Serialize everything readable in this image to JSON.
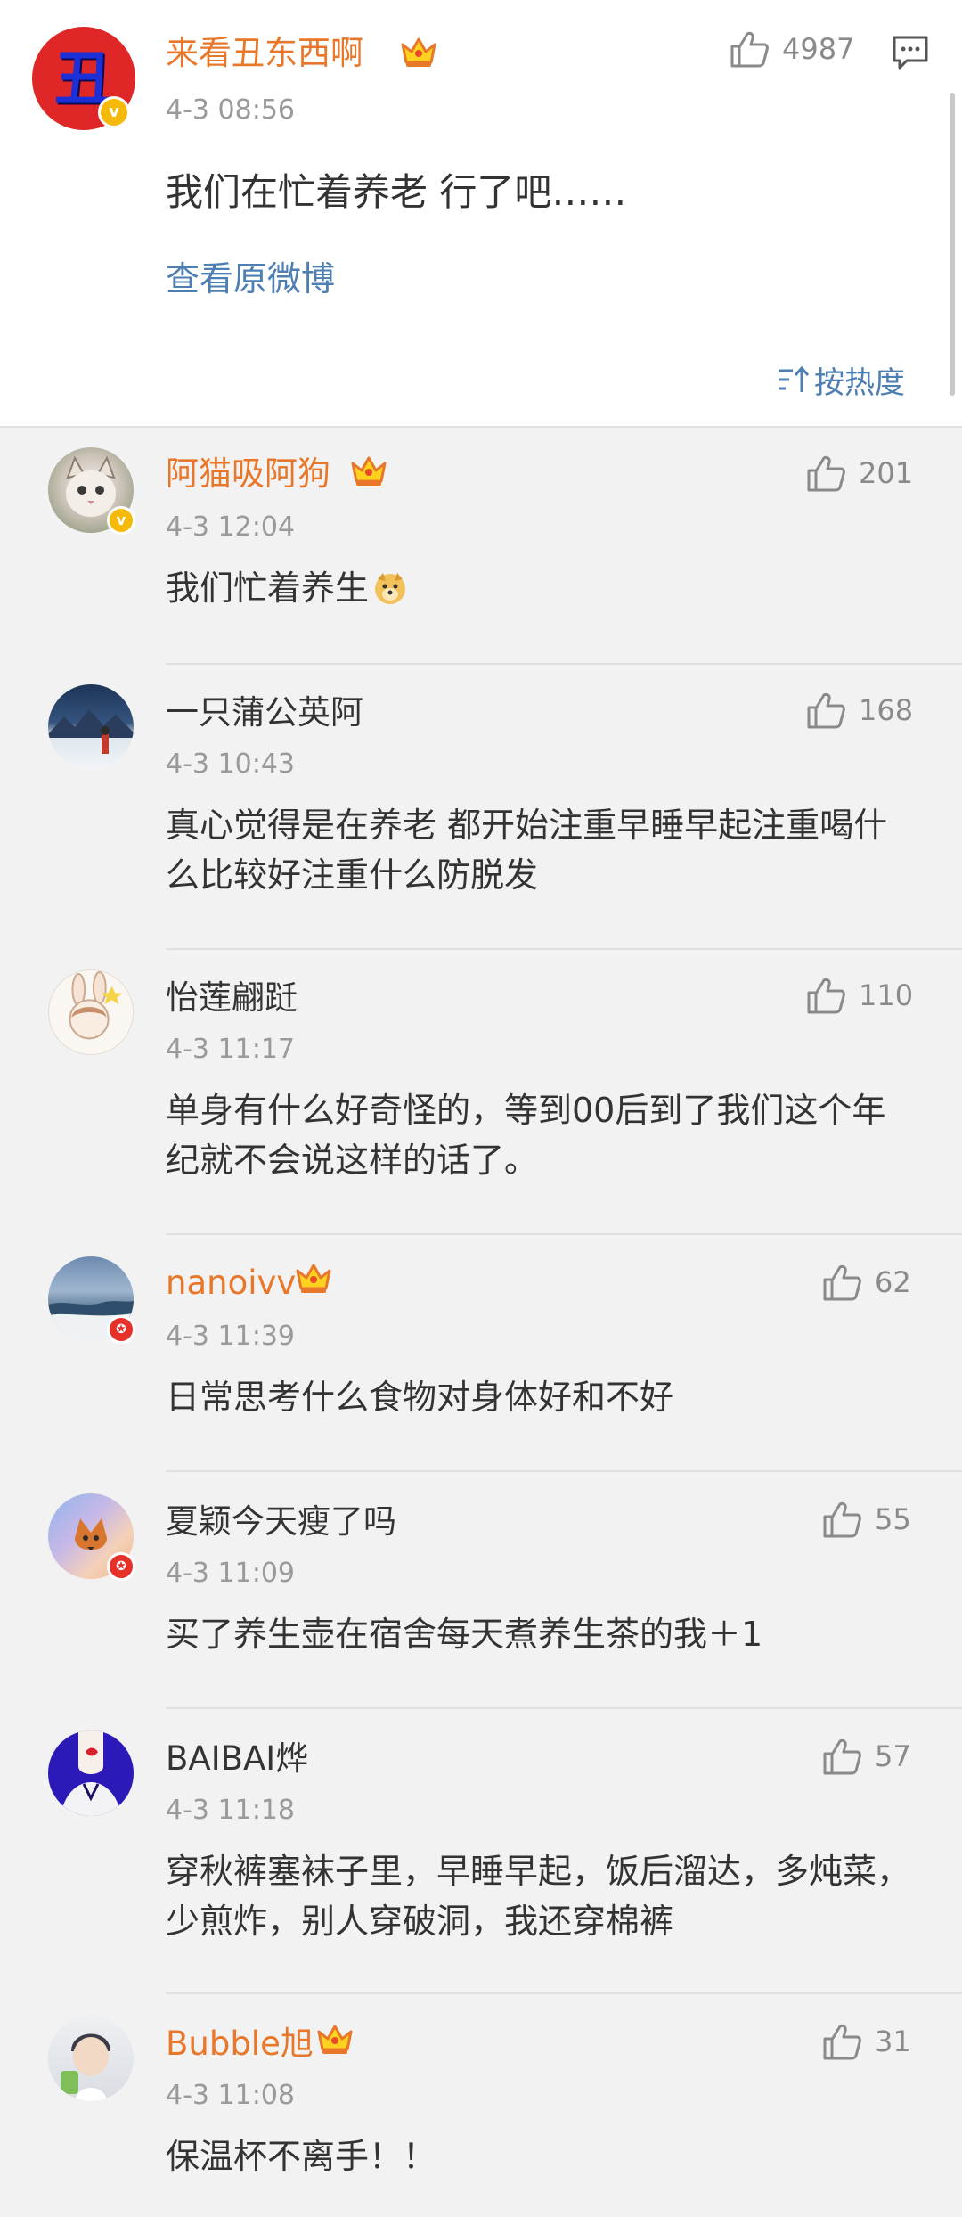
{
  "post": {
    "author": "来看丑东西啊",
    "avatar_glyph": "丑",
    "time": "4-3 08:56",
    "text": "我们在忙着养老  行了吧……",
    "likes": "4987",
    "view_original": "查看原微博",
    "sort_label": "按热度"
  },
  "comments": [
    {
      "name": "阿猫吸阿狗",
      "vip": true,
      "time": "4-3 12:04",
      "text": "我们忙着养生",
      "likes": "201"
    },
    {
      "name": "一只蒲公英阿",
      "vip": false,
      "time": "4-3 10:43",
      "text": "真心觉得是在养老  都开始注重早睡早起注重喝什么比较好注重什么防脱发",
      "likes": "168"
    },
    {
      "name": "怡莲翩跹",
      "vip": false,
      "time": "4-3 11:17",
      "text": "单身有什么好奇怪的，等到00后到了我们这个年纪就不会说这样的话了。",
      "likes": "110"
    },
    {
      "name": "nanoivv",
      "vip": true,
      "time": "4-3 11:39",
      "text": "日常思考什么食物对身体好和不好",
      "likes": "62"
    },
    {
      "name": "夏颖今天瘦了吗",
      "vip": false,
      "time": "4-3 11:09",
      "text": "买了养生壶在宿舍每天煮养生茶的我＋1",
      "likes": "55"
    },
    {
      "name": "BAIBAI烨",
      "vip": false,
      "time": "4-3 11:18",
      "text": "穿秋裤塞袜子里，早睡早起，饭后溜达，多炖菜，少煎炸，别人穿破洞，我还穿棉裤",
      "likes": "57"
    },
    {
      "name": "Bubble旭",
      "vip": true,
      "time": "4-3 11:08",
      "text": "保温杯不离手！！",
      "likes": "31"
    }
  ],
  "colors": {
    "vip_name": "#e8772a",
    "link": "#4d7fb3",
    "background": "#f2f2f2"
  },
  "icons": {
    "like": "thumbs-up-icon",
    "comment": "comment-icon",
    "vip": "crown-icon",
    "verified": "verified-badge-icon",
    "sort": "sort-icon"
  }
}
